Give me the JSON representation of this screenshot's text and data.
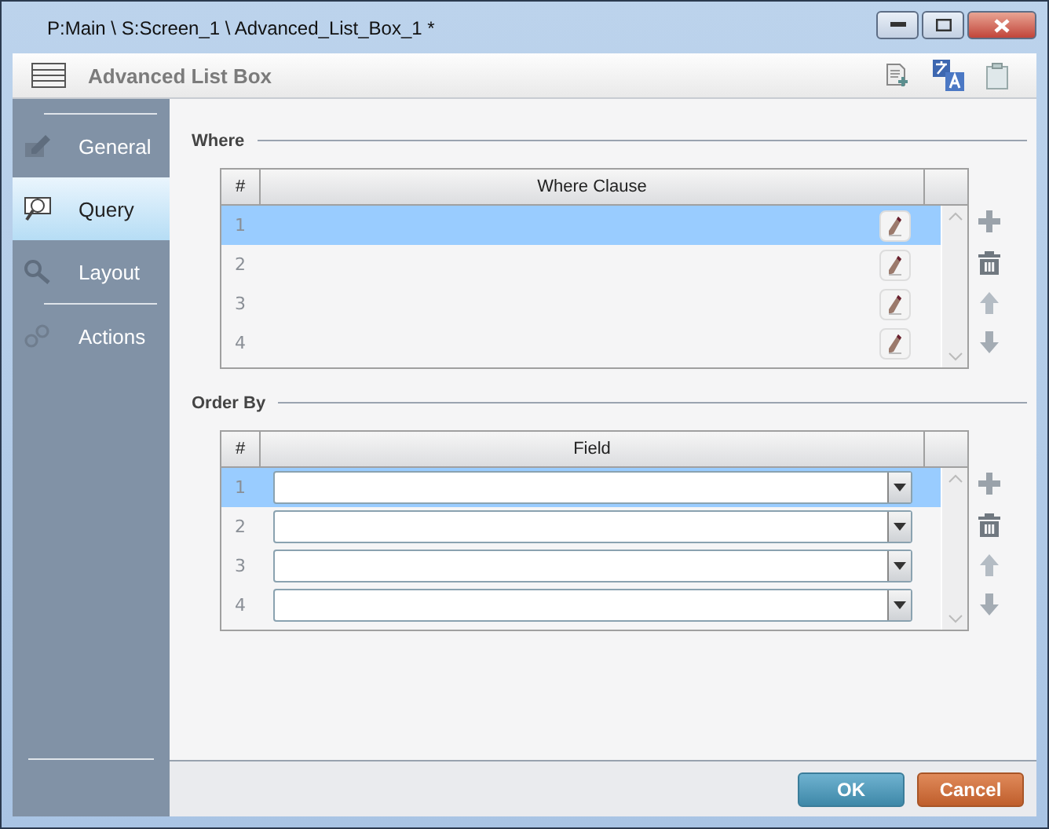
{
  "window": {
    "title": "P:Main \\ S:Screen_1 \\ Advanced_List_Box_1 *"
  },
  "header": {
    "title": "Advanced List Box"
  },
  "sidebar": {
    "items": [
      {
        "label": "General",
        "selected": false,
        "kind": "general"
      },
      {
        "label": "Query",
        "selected": true,
        "kind": "query"
      },
      {
        "label": "Layout",
        "selected": false,
        "kind": "layout"
      },
      {
        "label": "Actions",
        "selected": false,
        "kind": "actions"
      }
    ]
  },
  "where": {
    "title": "Where",
    "columns": [
      "#",
      "Where Clause"
    ],
    "rows": [
      {
        "number": "1",
        "selected": true
      },
      {
        "number": "2",
        "selected": false
      },
      {
        "number": "3",
        "selected": false
      },
      {
        "number": "4",
        "selected": false
      }
    ]
  },
  "order_by": {
    "title": "Order By",
    "columns": [
      "#",
      "Field"
    ],
    "rows": [
      {
        "number": "1",
        "selected": true
      },
      {
        "number": "2",
        "selected": false
      },
      {
        "number": "3",
        "selected": false
      },
      {
        "number": "4",
        "selected": false
      }
    ]
  },
  "buttons": [
    {
      "label": "OK",
      "kind": "ok"
    },
    {
      "label": "Cancel",
      "kind": "cancel"
    }
  ]
}
